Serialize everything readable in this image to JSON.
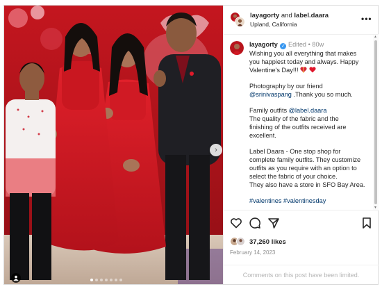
{
  "post": {
    "header": {
      "user1": "layagorty",
      "and_text": "and",
      "user2": "label.daara",
      "location": "Upland, California",
      "more_label": "•••"
    },
    "caption": {
      "username": "layagorty",
      "verified_glyph": "✓",
      "edited": "Edited",
      "separator": "•",
      "age": "80w",
      "lines": {
        "l1": "Wishing you all everything that makes",
        "l2": "you happiest today and always. Happy",
        "l3": "Valentine's Day!!!",
        "l4": "Photography by our friend",
        "l5_mention": "@srinivaspang",
        "l5_rest": " .Thank you so much.",
        "l6": "Family outfits ",
        "l6_mention": "@label.daara",
        "l7": "The quality of the fabric and the",
        "l8": "finishing of the outfits received are",
        "l9": "excellent.",
        "l10": "Label Daara - One stop shop for",
        "l11": "complete family outfits. They customize",
        "l12": "outfits as you require with an option to",
        "l13": "select the fabric of your choice.",
        "l14": "They also have a store in SFO Bay Area.",
        "l15": "#valentines #valentinesday"
      },
      "emoji_icons": [
        "ribbon-heart-icon",
        "red-heart-icon"
      ]
    },
    "actions": {
      "icons": [
        "heart-icon",
        "comment-icon",
        "share-icon",
        "bookmark-icon"
      ],
      "likes": "37,260 likes",
      "date": "February 14, 2023",
      "comments_limited": "Comments on this post have been limited."
    },
    "media": {
      "carousel_position": 1,
      "carousel_count": 7,
      "next_glyph": "›"
    },
    "colors": {
      "link": "#00376b",
      "muted": "#8e8e8e",
      "verified": "#3897f0",
      "background_red": "#b8141c"
    }
  }
}
